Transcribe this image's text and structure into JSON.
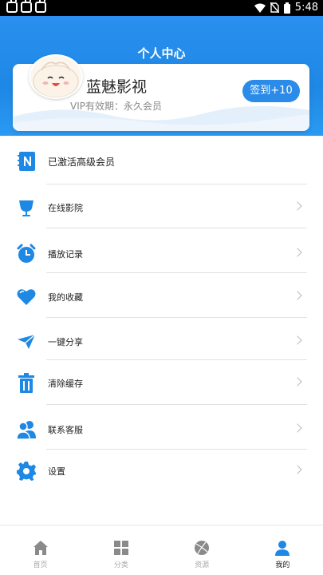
{
  "status_bar": {
    "time": "5:48",
    "icons": [
      "bug-icon",
      "bug-icon",
      "bug-icon",
      "wifi-icon",
      "no-sim-icon",
      "battery-icon"
    ]
  },
  "header": {
    "title": "个人中心"
  },
  "profile": {
    "username": "蓝魅影视",
    "vip_label": "VIP有效期：永久会员",
    "checkin_label": "签到+10",
    "avatar_icon": "bun-mascot-avatar"
  },
  "menu": {
    "items": [
      {
        "label": "已激活高级会员",
        "icon": "notebook-n-icon"
      },
      {
        "label": "在线影院",
        "icon": "cinema-cup-icon"
      },
      {
        "label": "播放记录",
        "icon": "alarm-clock-icon"
      },
      {
        "label": "我的收藏",
        "icon": "heart-icon"
      },
      {
        "label": "一键分享",
        "icon": "paper-plane-icon"
      },
      {
        "label": "清除缓存",
        "icon": "trash-icon"
      },
      {
        "label": "联系客服",
        "icon": "contacts-icon"
      },
      {
        "label": "设置",
        "icon": "gear-icon"
      }
    ]
  },
  "bottom_nav": {
    "items": [
      {
        "label": "首页",
        "icon": "home-icon"
      },
      {
        "label": "分类",
        "icon": "grid-icon"
      },
      {
        "label": "资源",
        "icon": "basketball-icon"
      },
      {
        "label": "我的",
        "icon": "person-icon"
      }
    ],
    "active": "我的"
  },
  "colors": {
    "primary_blue": "#1e88e5",
    "icon_blue": "#1e88e5",
    "text_dark": "#222222",
    "text_gray": "#888888",
    "divider": "#e2e2e2"
  }
}
